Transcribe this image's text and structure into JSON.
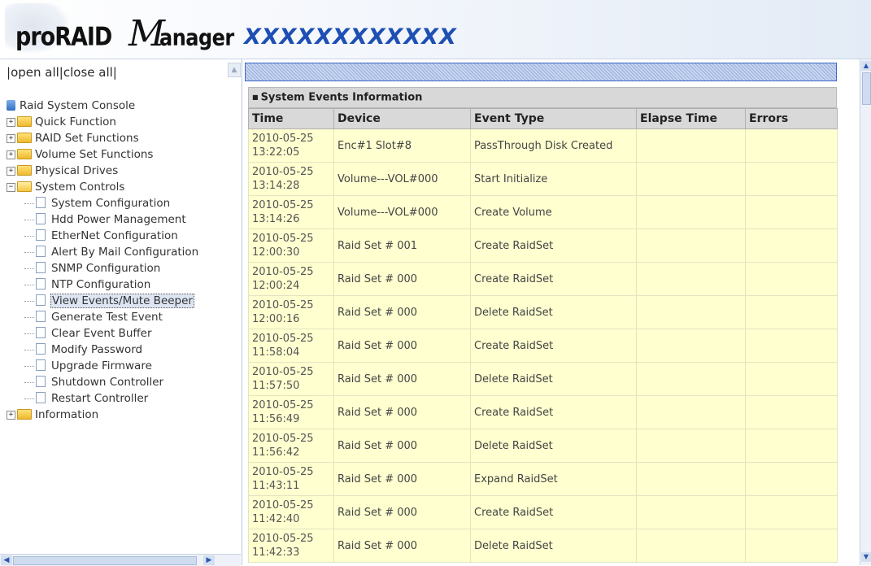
{
  "header": {
    "brand_pro": "proRAID",
    "brand_m": "M",
    "brand_anager": "anager",
    "model": "XXXXXXXXXXXX"
  },
  "sidebar": {
    "open_all": "open all",
    "close_all": "close all",
    "root_label": "Raid System Console",
    "groups": [
      {
        "label": "Quick Function",
        "expanded": false
      },
      {
        "label": "RAID Set Functions",
        "expanded": false
      },
      {
        "label": "Volume Set Functions",
        "expanded": false
      },
      {
        "label": "Physical Drives",
        "expanded": false
      },
      {
        "label": "System Controls",
        "expanded": true
      },
      {
        "label": "Information",
        "expanded": false
      }
    ],
    "system_controls_items": [
      "System Configuration",
      "Hdd Power Management",
      "EtherNet Configuration",
      "Alert By Mail Configuration",
      "SNMP Configuration",
      "NTP Configuration",
      "View Events/Mute Beeper",
      "Generate Test Event",
      "Clear Event Buffer",
      "Modify Password",
      "Upgrade Firmware",
      "Shutdown Controller",
      "Restart Controller"
    ],
    "selected_item": "View Events/Mute Beeper"
  },
  "panel": {
    "title": "System Events Information",
    "columns": [
      "Time",
      "Device",
      "Event Type",
      "Elapse Time",
      "Errors"
    ],
    "rows": [
      {
        "date": "2010-05-25",
        "time": "13:22:05",
        "device": "Enc#1 Slot#8",
        "event": "PassThrough Disk Created",
        "elapse": "",
        "errors": ""
      },
      {
        "date": "2010-05-25",
        "time": "13:14:28",
        "device": "Volume---VOL#000",
        "event": "Start Initialize",
        "elapse": "",
        "errors": ""
      },
      {
        "date": "2010-05-25",
        "time": "13:14:26",
        "device": "Volume---VOL#000",
        "event": "Create Volume",
        "elapse": "",
        "errors": ""
      },
      {
        "date": "2010-05-25",
        "time": "12:00:30",
        "device": "Raid Set # 001",
        "event": "Create RaidSet",
        "elapse": "",
        "errors": ""
      },
      {
        "date": "2010-05-25",
        "time": "12:00:24",
        "device": "Raid Set # 000",
        "event": "Create RaidSet",
        "elapse": "",
        "errors": ""
      },
      {
        "date": "2010-05-25",
        "time": "12:00:16",
        "device": "Raid Set # 000",
        "event": "Delete RaidSet",
        "elapse": "",
        "errors": ""
      },
      {
        "date": "2010-05-25",
        "time": "11:58:04",
        "device": "Raid Set # 000",
        "event": "Create RaidSet",
        "elapse": "",
        "errors": ""
      },
      {
        "date": "2010-05-25",
        "time": "11:57:50",
        "device": "Raid Set # 000",
        "event": "Delete RaidSet",
        "elapse": "",
        "errors": ""
      },
      {
        "date": "2010-05-25",
        "time": "11:56:49",
        "device": "Raid Set # 000",
        "event": "Create RaidSet",
        "elapse": "",
        "errors": ""
      },
      {
        "date": "2010-05-25",
        "time": "11:56:42",
        "device": "Raid Set # 000",
        "event": "Delete RaidSet",
        "elapse": "",
        "errors": ""
      },
      {
        "date": "2010-05-25",
        "time": "11:43:11",
        "device": "Raid Set # 000",
        "event": "Expand RaidSet",
        "elapse": "",
        "errors": ""
      },
      {
        "date": "2010-05-25",
        "time": "11:42:40",
        "device": "Raid Set # 000",
        "event": "Create RaidSet",
        "elapse": "",
        "errors": ""
      },
      {
        "date": "2010-05-25",
        "time": "11:42:33",
        "device": "Raid Set # 000",
        "event": "Delete RaidSet",
        "elapse": "",
        "errors": ""
      }
    ]
  },
  "colors": {
    "accent": "#1d4fb4",
    "row_bg": "#ffffd0",
    "header_bg": "#d9d9d9"
  }
}
